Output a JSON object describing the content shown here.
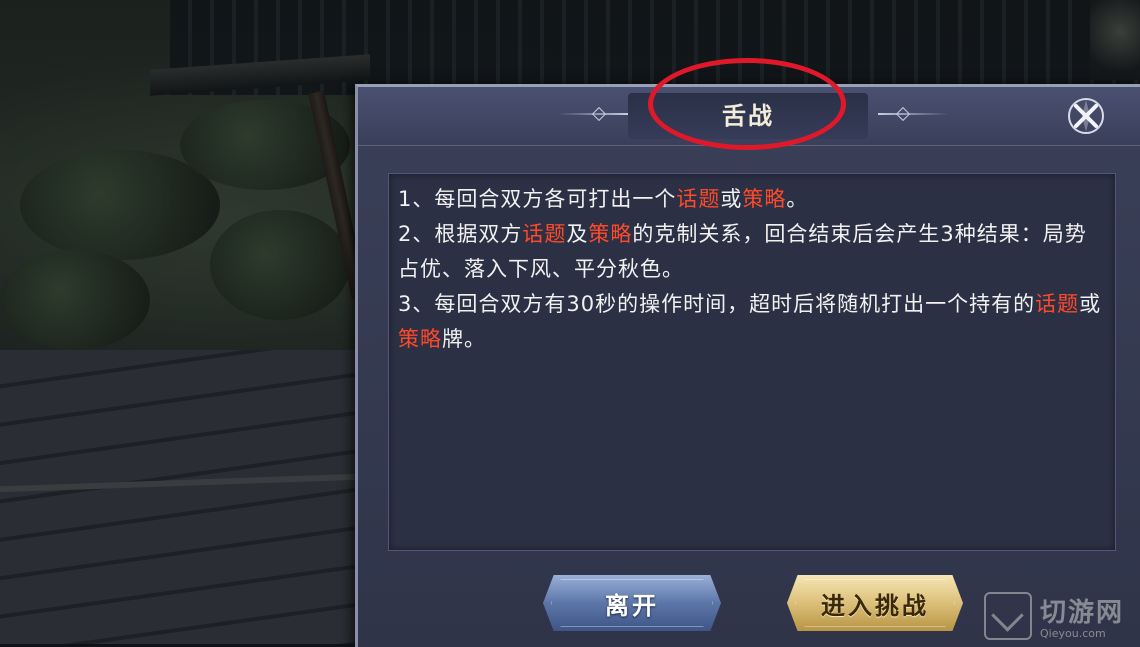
{
  "dialog": {
    "title": "舌战",
    "rules": [
      [
        {
          "text": "1、每回合双方各可打出一个",
          "hl": false
        },
        {
          "text": "话题",
          "hl": true
        },
        {
          "text": "或",
          "hl": false
        },
        {
          "text": "策略",
          "hl": true
        },
        {
          "text": "。",
          "hl": false
        }
      ],
      [
        {
          "text": "2、根据双方",
          "hl": false
        },
        {
          "text": "话题",
          "hl": true
        },
        {
          "text": "及",
          "hl": false
        },
        {
          "text": "策略",
          "hl": true
        },
        {
          "text": "的克制关系，回合结束后会产生3种结果：局势占优、落入下风、平分秋色。",
          "hl": false
        }
      ],
      [
        {
          "text": "3、每回合双方有30秒的操作时间，超时后将随机打出一个持有的",
          "hl": false
        },
        {
          "text": "话题",
          "hl": true
        },
        {
          "text": "或",
          "hl": false
        },
        {
          "text": "策略",
          "hl": true
        },
        {
          "text": "牌。",
          "hl": false
        }
      ]
    ],
    "buttons": {
      "leave": "离开",
      "enter": "进入挑战"
    }
  },
  "watermark": {
    "main": "切游网",
    "sub": "Qieyou.com"
  },
  "colors": {
    "highlight": "#ff4a2a",
    "annotation_circle": "#e0192a",
    "panel": "#2c3044"
  },
  "icons": {
    "close": "close-icon"
  }
}
